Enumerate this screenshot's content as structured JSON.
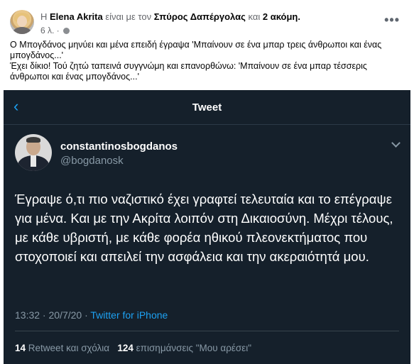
{
  "facebook_post": {
    "prefix": "Η",
    "author": "Elena Akrita",
    "with_text": "είναι με τον",
    "tagged": "Σπύρος Δαπέργολας",
    "and_text": "και",
    "others": "2 ακόμη.",
    "time": "6 λ. ·",
    "privacy_icon": "globe-icon",
    "menu_icon": "more-dots-icon",
    "paragraph1": "Ο Μπογδάνος μηνύει και μένα επειδή έγραψα 'Μπαίνουν σε ένα μπαρ τρεις άνθρωποι και ένας μπογδάνος...'",
    "paragraph2": "Έχει δίκιο! Τού ζητώ ταπεινά συγγνώμη και επανορθώνω: 'Μπαίνουν σε ένα μπαρ τέσσερις άνθρωποι και ένας μπογδάνος...'"
  },
  "tweet": {
    "back_icon": "chevron-left-icon",
    "header_title": "Tweet",
    "display_name": "constantinosbogdanos",
    "handle": "@bogdanosk",
    "text": "Έγραψε ό,τι πιο ναζιστικό έχει γραφτεί τελευταία και το επέγραψε για μένα. Και με την Ακρίτα λοιπόν στη Δικαιοσύνη. Μέχρι τέλους, με κάθε υβριστή, με κάθε φορέα ηθικού πλεονεκτήματος που στοχοποιεί και απειλεί την ασφάλεια και την ακεραιότητά μου.",
    "timestamp": "13:32 · 20/7/20 ·",
    "source": "Twitter for iPhone",
    "retweet_count": "14",
    "retweet_label": "Retweet και σχόλια",
    "likes_count": "124",
    "likes_label": "επισημάνσεις \"Μου αρέσει\""
  },
  "colors": {
    "tweet_bg": "#15202b",
    "accent": "#1da1f2",
    "muted": "#8899a6"
  }
}
